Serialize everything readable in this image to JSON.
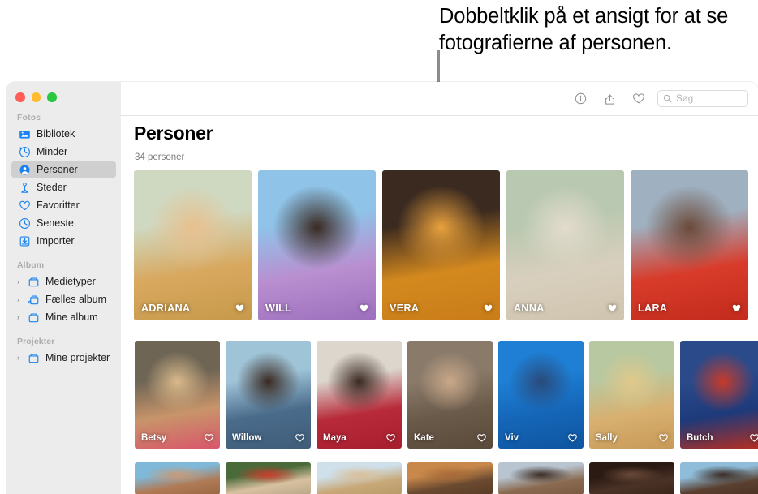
{
  "callout": {
    "text": "Dobbeltklik på et ansigt for at se fotografierne af personen."
  },
  "window": {
    "traffic_lights": [
      "close",
      "minimize",
      "zoom"
    ]
  },
  "sidebar": {
    "sections": [
      {
        "header": "Fotos",
        "items": [
          {
            "label": "Bibliotek",
            "icon": "photos-library-icon",
            "selected": false,
            "disclosure": false
          },
          {
            "label": "Minder",
            "icon": "memories-icon",
            "selected": false,
            "disclosure": false
          },
          {
            "label": "Personer",
            "icon": "people-icon",
            "selected": true,
            "disclosure": false
          },
          {
            "label": "Steder",
            "icon": "places-pin-icon",
            "selected": false,
            "disclosure": false
          },
          {
            "label": "Favoritter",
            "icon": "heart-icon",
            "selected": false,
            "disclosure": false
          },
          {
            "label": "Seneste",
            "icon": "clock-icon",
            "selected": false,
            "disclosure": false
          },
          {
            "label": "Importer",
            "icon": "import-icon",
            "selected": false,
            "disclosure": false
          }
        ]
      },
      {
        "header": "Album",
        "items": [
          {
            "label": "Medietyper",
            "icon": "folder-icon",
            "selected": false,
            "disclosure": true
          },
          {
            "label": "Fælles album",
            "icon": "shared-folder-icon",
            "selected": false,
            "disclosure": true
          },
          {
            "label": "Mine album",
            "icon": "folder-icon",
            "selected": false,
            "disclosure": true
          }
        ]
      },
      {
        "header": "Projekter",
        "items": [
          {
            "label": "Mine projekter",
            "icon": "folder-icon",
            "selected": false,
            "disclosure": true
          }
        ]
      }
    ]
  },
  "toolbar": {
    "icons": [
      {
        "name": "info-icon",
        "glyph": "info"
      },
      {
        "name": "share-icon",
        "glyph": "share"
      },
      {
        "name": "favorite-heart-icon",
        "glyph": "heart"
      }
    ],
    "search": {
      "placeholder": "Søg",
      "value": "",
      "icon": "search-icon"
    }
  },
  "main": {
    "title": "Personer",
    "subtitle": "34 personer"
  },
  "grid": {
    "rows": [
      {
        "id": "row1",
        "tiles": [
          {
            "name": "ADRIANA",
            "favorite": true,
            "colors": [
              "#cfd9c2",
              "#e8c08e",
              "#d8a85f",
              "#c79a4a"
            ]
          },
          {
            "name": "WILL",
            "favorite": true,
            "colors": [
              "#8fc3e8",
              "#3a2a22",
              "#b98fd0",
              "#9d6fbd"
            ]
          },
          {
            "name": "VERA",
            "favorite": true,
            "colors": [
              "#3b2a20",
              "#e8a13c",
              "#d4891f",
              "#c97c18"
            ]
          },
          {
            "name": "ANNA",
            "favorite": true,
            "colors": [
              "#b9c8b0",
              "#e3dccd",
              "#d9cfbe",
              "#cfc4ae"
            ]
          },
          {
            "name": "LARA",
            "favorite": true,
            "colors": [
              "#9fb0c0",
              "#6b4a3a",
              "#d83b2a",
              "#c32b1c"
            ]
          }
        ]
      },
      {
        "id": "row2",
        "tiles": [
          {
            "name": "Betsy",
            "favorite": false,
            "colors": [
              "#6e6555",
              "#d9b98a",
              "#c8946a",
              "#d9566a"
            ]
          },
          {
            "name": "Willow",
            "favorite": false,
            "colors": [
              "#9fc4d8",
              "#3a2a22",
              "#4a6b8a",
              "#3f5d7a"
            ]
          },
          {
            "name": "Maya",
            "favorite": false,
            "colors": [
              "#dcd6cd",
              "#3a2a22",
              "#b82a3a",
              "#a81e2e"
            ]
          },
          {
            "name": "Kate",
            "favorite": false,
            "colors": [
              "#8a7a6a",
              "#c9a888",
              "#6a5a4a",
              "#5a4a3a"
            ]
          },
          {
            "name": "Viv",
            "favorite": false,
            "colors": [
              "#1e7fd4",
              "#2a4a7a",
              "#1566b8",
              "#0f55a0"
            ]
          },
          {
            "name": "Sally",
            "favorite": false,
            "colors": [
              "#b8c8a0",
              "#e0c88a",
              "#d8b070",
              "#c89a58"
            ]
          },
          {
            "name": "Butch",
            "favorite": false,
            "colors": [
              "#2a4a8a",
              "#c83a2a",
              "#1e3a7a",
              "#b82e20"
            ]
          }
        ]
      },
      {
        "id": "row3",
        "tiles": [
          {
            "name": "",
            "favorite": false,
            "colors": [
              "#7fb8d8",
              "#c89a78",
              "#b07a55",
              "#9a6845"
            ]
          },
          {
            "name": "",
            "favorite": false,
            "colors": [
              "#4a6a3a",
              "#c83a2a",
              "#d8c0a0",
              "#b8a888"
            ]
          },
          {
            "name": "",
            "favorite": false,
            "colors": [
              "#cfe0ea",
              "#d9c09a",
              "#c8a878",
              "#b89a68"
            ]
          },
          {
            "name": "",
            "favorite": false,
            "colors": [
              "#c8884a",
              "#a86a38",
              "#6a4a30",
              "#5a3c26"
            ]
          },
          {
            "name": "",
            "favorite": false,
            "colors": [
              "#b8c4cf",
              "#3a2a22",
              "#8a6a50",
              "#7a5a40"
            ]
          },
          {
            "name": "",
            "favorite": false,
            "colors": [
              "#2a1a12",
              "#6a4a38",
              "#4a3226",
              "#3a2518"
            ]
          },
          {
            "name": "",
            "favorite": false,
            "colors": [
              "#8fbcd8",
              "#3a2a22",
              "#5a4030",
              "#4a3224"
            ]
          }
        ]
      }
    ]
  },
  "colors": {
    "accent_blue": "#1a82f0",
    "sidebar_bg": "#ececec",
    "selected_bg": "#cfcfcf",
    "title_text": "#000000",
    "subtitle_text": "#7c7c7c",
    "callout_line": "#8c8c8c"
  }
}
